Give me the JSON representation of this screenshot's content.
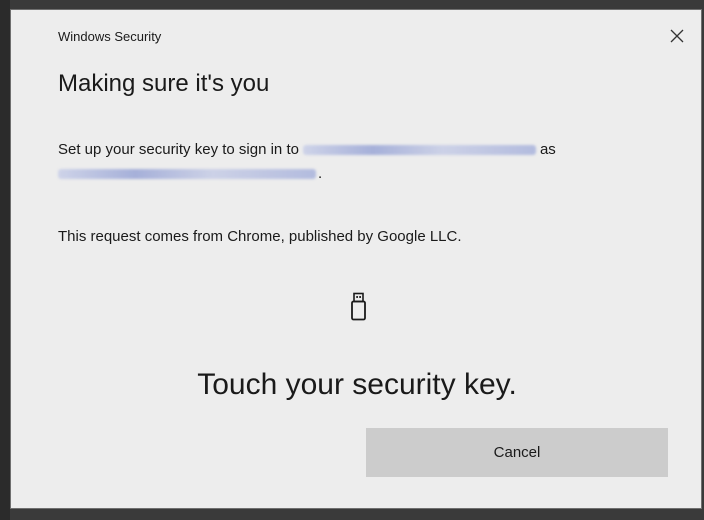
{
  "dialog": {
    "window_title": "Windows Security",
    "close_glyph": "✕",
    "heading": "Making sure it's you",
    "setup_prefix": "Set up your security key to sign in to",
    "setup_as": "as",
    "setup_period": ".",
    "request_text": "This request comes from Chrome, published by Google LLC.",
    "icon": "usb-security-key-icon",
    "touch_text": "Touch your security key.",
    "cancel_label": "Cancel"
  }
}
